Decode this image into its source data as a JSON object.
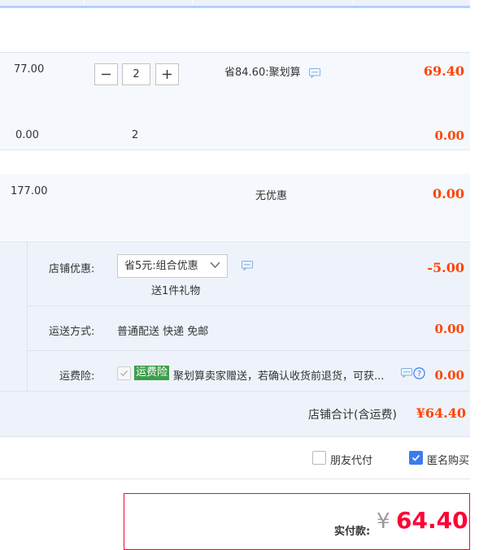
{
  "items": [
    {
      "unit_price": "77.00",
      "quantity": "2",
      "discount": "省84.60:聚划算",
      "subtotal": "69.40"
    },
    {
      "unit_price": "0.00",
      "quantity": "2",
      "subtotal": "0.00"
    },
    {
      "unit_price": "177.00",
      "discount": "无优惠",
      "subtotal": "0.00"
    }
  ],
  "shop": {
    "coupon_label": "店铺优惠:",
    "coupon_selected": "省5元:组合优惠",
    "coupon_gift": "送1件礼物",
    "coupon_amount": "-5.00",
    "shipping_label": "运送方式:",
    "shipping_method": "普通配送 快递 免邮",
    "shipping_amount": "0.00",
    "insurance_label": "运费险:",
    "insurance_badge": "运费险",
    "insurance_text": "聚划算卖家赠送，若确认收货前退货，可获...",
    "insurance_amount": "0.00",
    "total_label": "店铺合计(含运费)",
    "total_amount": "¥64.40"
  },
  "options": {
    "friend_pay": "朋友代付",
    "anonymous": "匿名购买"
  },
  "pay": {
    "label": "实付款:",
    "currency": "¥",
    "amount": "64.40"
  },
  "colors": {
    "price": "#ff4400",
    "panel": "#f5f8fd",
    "accent_blue": "#3b7bef",
    "badge_green": "#3c9f4a"
  }
}
